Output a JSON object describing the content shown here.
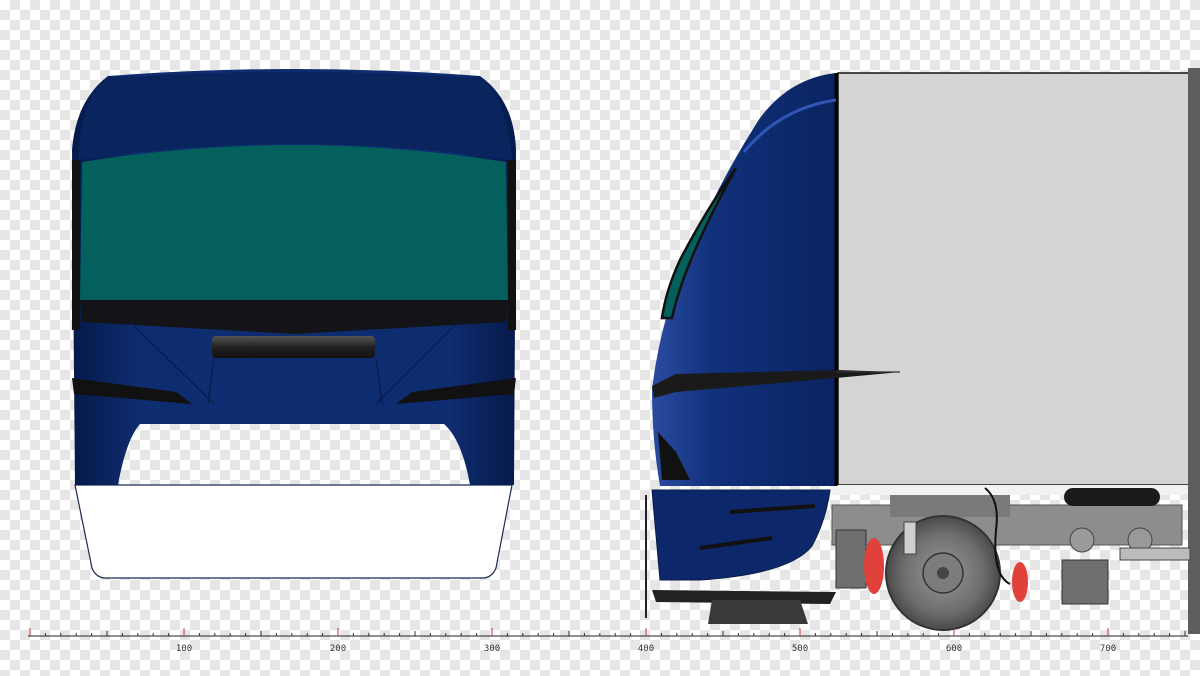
{
  "ruler": {
    "labels": [
      "100",
      "200",
      "300",
      "400",
      "500",
      "600",
      "700"
    ]
  },
  "colors": {
    "body_blue": "#0d2a6b",
    "body_blue_dark": "#071a45",
    "windshield": "#04605d",
    "car_side": "#d4d4d4",
    "bogie": "#8d8d8d",
    "brake_red": "#e0413a"
  }
}
